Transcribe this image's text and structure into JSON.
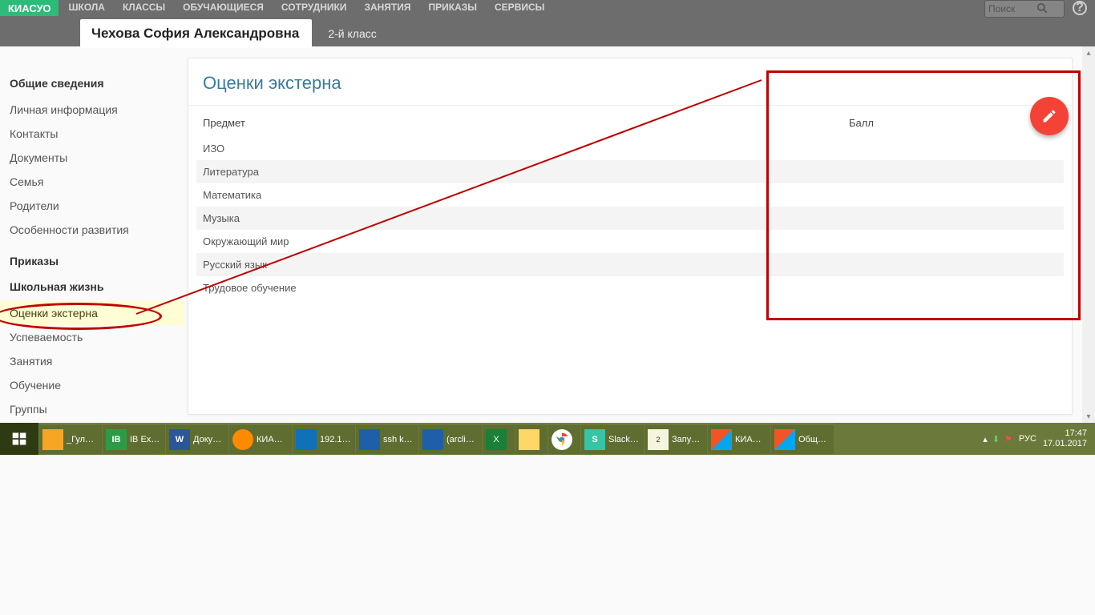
{
  "header": {
    "logo": "КИАСУО",
    "nav": [
      "ШКОЛА",
      "КЛАССЫ",
      "ОБУЧАЮЩИЕСЯ",
      "СОТРУДНИКИ",
      "ЗАНЯТИЯ",
      "ПРИКАЗЫ",
      "СЕРВИСЫ"
    ],
    "search_placeholder": "Поиск"
  },
  "tabs": {
    "student_name": "Чехова София Александровна",
    "class_label": "2-й класс"
  },
  "sidebar": {
    "section1_title": "Общие сведения",
    "section1_items": [
      "Личная информация",
      "Контакты",
      "Документы",
      "Семья",
      "Родители",
      "Особенности развития"
    ],
    "section2_title": "Приказы",
    "section3_title": "Школьная жизнь",
    "section3_items": [
      "Оценки экстерна",
      "Успеваемость",
      "Занятия",
      "Обучение",
      "Группы"
    ]
  },
  "panel": {
    "title": "Оценки экстерна",
    "col_subject": "Предмет",
    "col_score": "Балл",
    "rows": [
      "ИЗО",
      "Литература",
      "Математика",
      "Музыка",
      "Окружающий мир",
      "Русский язык",
      "Трудовое обучение"
    ]
  },
  "taskbar": {
    "items": [
      {
        "label": "_Гул…",
        "color": "#f6a623"
      },
      {
        "label": "IB Ex…",
        "color": "#2d9b46"
      },
      {
        "label": "Доку…",
        "color": "#2b579a"
      },
      {
        "label": "КИА…",
        "color": "#ff8a00"
      },
      {
        "label": "192.1…",
        "color": "#1070b8"
      },
      {
        "label": "ssh k…",
        "color": "#1f5faa"
      },
      {
        "label": "(arcli…",
        "color": "#1f5faa"
      },
      {
        "label": "",
        "color": "#1a7f37"
      },
      {
        "label": "",
        "color": "#ffd766"
      },
      {
        "label": "",
        "color": "#ffffff"
      },
      {
        "label": "Slack…",
        "color": "#36c5a4"
      },
      {
        "label": "Запу…",
        "color": "#9fae55"
      },
      {
        "label": "КИА…",
        "color": "#f35325"
      },
      {
        "label": "Общ…",
        "color": "#f35325"
      }
    ],
    "lang": "РУС",
    "time": "17:47",
    "date": "17.01.2017"
  }
}
